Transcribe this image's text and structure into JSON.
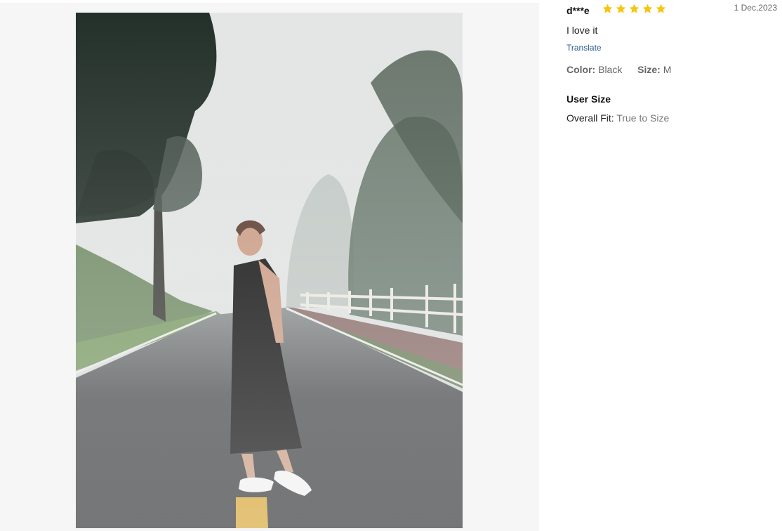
{
  "review": {
    "reviewer": "d***e",
    "rating": 5,
    "rating_max": 5,
    "date": "1 Dec,2023",
    "text": "I love it",
    "translate_label": "Translate",
    "color_label": "Color:",
    "color_value": "Black",
    "size_label": "Size:",
    "size_value": "M",
    "user_size_title": "User Size",
    "fit_label": "Overall Fit:",
    "fit_value": "True to Size"
  },
  "colors": {
    "star": "#f7c614",
    "link": "#2b5b8f",
    "panel_bg": "#f6f6f6"
  },
  "icons": {
    "rating": "star-icon"
  }
}
